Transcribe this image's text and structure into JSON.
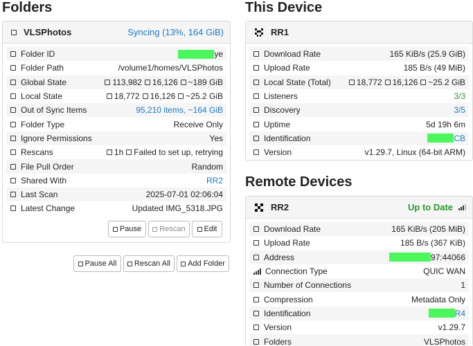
{
  "folders": {
    "heading": "Folders",
    "panel": {
      "name": "VLSPhotos",
      "status": "Syncing (13%, 164 GiB)",
      "rows": [
        {
          "label": "Folder ID",
          "value": "ye",
          "redacted": true
        },
        {
          "label": "Folder Path",
          "value": "/volume1/homes/VLSPhotos"
        },
        {
          "label": "Global State",
          "value": [
            "113,982",
            "16,126",
            "~189 GiB"
          ]
        },
        {
          "label": "Local State",
          "value": [
            "18,772",
            "16,126",
            "~25.2 GiB"
          ]
        },
        {
          "label": "Out of Sync Items",
          "value": "95,210 items, ~164 GiB"
        },
        {
          "label": "Folder Type",
          "value": "Receive Only"
        },
        {
          "label": "Ignore Permissions",
          "value": "Yes"
        },
        {
          "label": "Rescans",
          "value": [
            "1h",
            "Failed to set up, retrying"
          ]
        },
        {
          "label": "File Pull Order",
          "value": "Random"
        },
        {
          "label": "Shared With",
          "value": "RR2"
        },
        {
          "label": "Last Scan",
          "value": "2025-07-01 02:06:04"
        },
        {
          "label": "Latest Change",
          "value": "Updated IMG_5318.JPG"
        }
      ],
      "buttons": {
        "pause": "Pause",
        "rescan": "Rescan",
        "edit": "Edit"
      }
    },
    "global_buttons": {
      "pause_all": "Pause All",
      "rescan_all": "Rescan All",
      "add_folder": "Add Folder"
    }
  },
  "this_device": {
    "heading": "This Device",
    "panel": {
      "name": "RR1",
      "rows": [
        {
          "label": "Download Rate",
          "value": "165 KiB/s (25.9 GiB)"
        },
        {
          "label": "Upload Rate",
          "value": "185 B/s (49 MiB)"
        },
        {
          "label": "Local State (Total)",
          "value": [
            "18,772",
            "16,126",
            "~25.2 GiB"
          ]
        },
        {
          "label": "Listeners",
          "value": "3/3"
        },
        {
          "label": "Discovery",
          "value": "3/5"
        },
        {
          "label": "Uptime",
          "value": "5d 19h 6m"
        },
        {
          "label": "Identification",
          "value": "CB",
          "redacted": true
        },
        {
          "label": "Version",
          "value": "v1.29.7, Linux (64-bit ARM)"
        }
      ]
    }
  },
  "remote_devices": {
    "heading": "Remote Devices",
    "panel": {
      "name": "RR2",
      "status": "Up to Date",
      "rows": [
        {
          "label": "Download Rate",
          "value": "165 KiB/s (205 MiB)"
        },
        {
          "label": "Upload Rate",
          "value": "185 B/s (367 KiB)"
        },
        {
          "label": "Address",
          "value": "97:44066",
          "redacted": true
        },
        {
          "label": "Connection Type",
          "value": "QUIC WAN"
        },
        {
          "label": "Number of Connections",
          "value": "1"
        },
        {
          "label": "Compression",
          "value": "Metadata Only"
        },
        {
          "label": "Identification",
          "value": "R4",
          "redacted": true
        },
        {
          "label": "Version",
          "value": "v1.29.7"
        },
        {
          "label": "Folders",
          "value": "VLSPhotos"
        }
      ]
    }
  },
  "colors": {
    "link": "#1c7ac4",
    "success": "#2a9a2a",
    "redaction": "#4cf75e"
  }
}
